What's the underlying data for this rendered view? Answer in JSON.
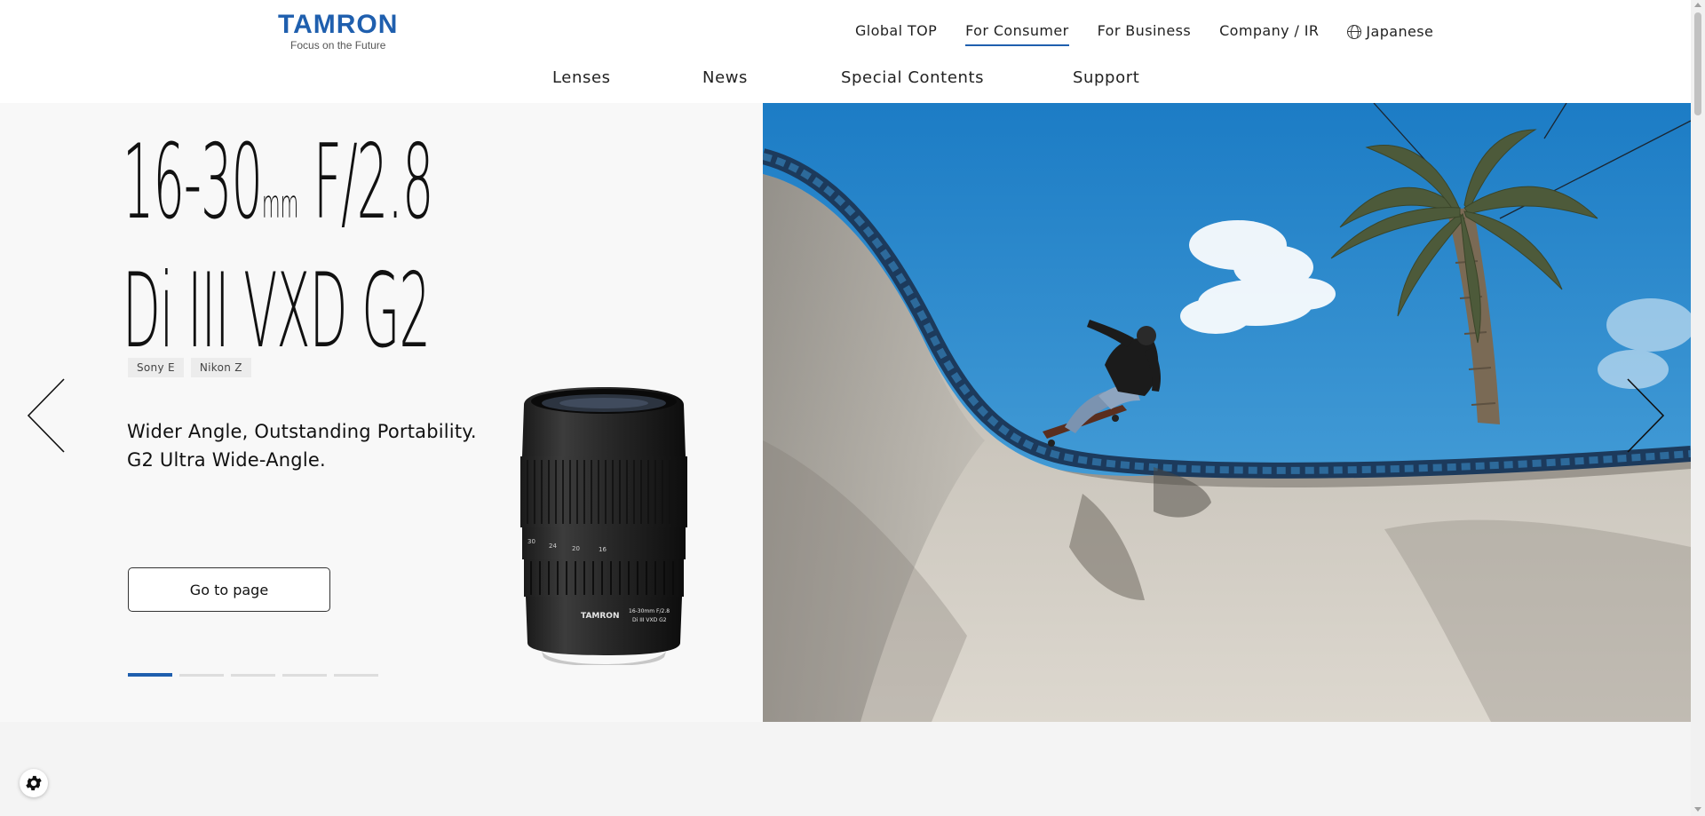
{
  "brand": {
    "logo_text": "TAMRON",
    "tagline": "Focus on the Future",
    "color": "#1f5fae"
  },
  "topnav": {
    "items": [
      {
        "label": "Global TOP",
        "active": false
      },
      {
        "label": "For Consumer",
        "active": true
      },
      {
        "label": "For Business",
        "active": false
      },
      {
        "label": "Company / IR",
        "active": false
      }
    ],
    "language": {
      "label": "Japanese",
      "icon": "globe-icon"
    }
  },
  "mainnav": {
    "items": [
      "Lenses",
      "News",
      "Special Contents",
      "Support"
    ]
  },
  "hero": {
    "title_line1_main": "16-30",
    "title_line1_unit": "mm",
    "title_line1_aperture": " F/2.8",
    "title_line2": "Di III VXD G2",
    "mounts": [
      "Sony E",
      "Nikon Z"
    ],
    "tagline_line1": "Wider Angle, Outstanding Portability.",
    "tagline_line2": "G2 Ultra Wide-Angle.",
    "cta_label": "Go to page",
    "slide_count": 5,
    "active_slide": 1,
    "lens_brand": "TAMRON",
    "lens_label_1": "16-30mm F/2.8",
    "lens_label_2": "Di III VXD G2",
    "lens_scale": [
      "30",
      "24",
      "20",
      "16"
    ]
  },
  "icons": {
    "prev": "chevron-left-icon",
    "next": "chevron-right-icon",
    "cookie_settings": "gear-icon"
  }
}
